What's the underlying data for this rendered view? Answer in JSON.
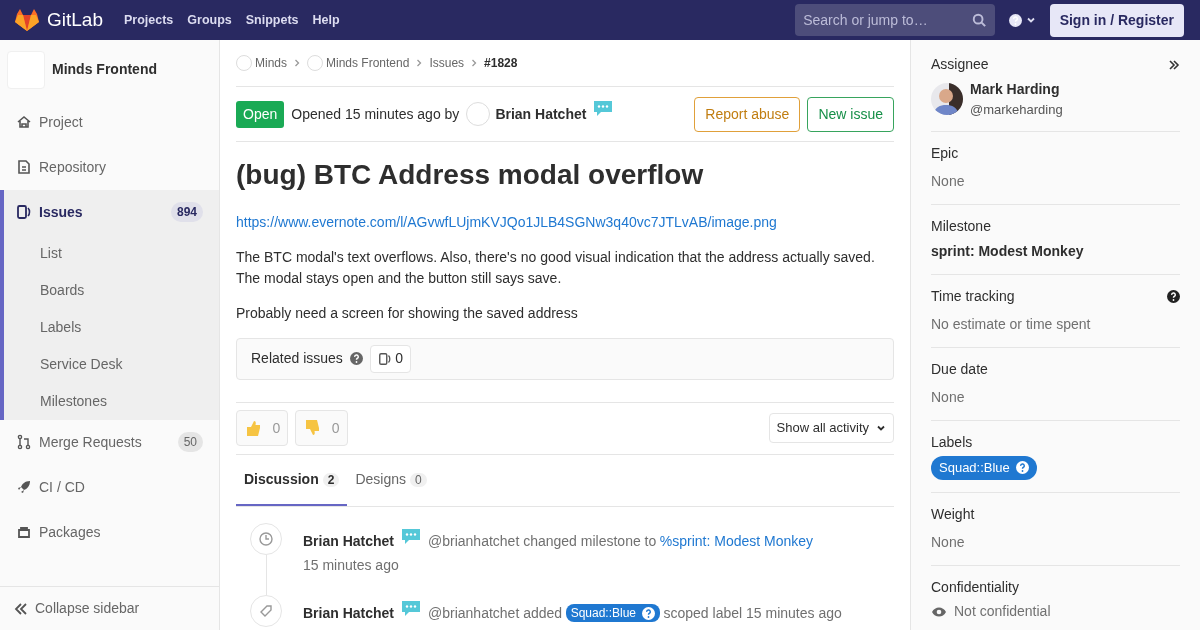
{
  "navbar": {
    "brand": "GitLab",
    "links": [
      "Projects",
      "Groups",
      "Snippets",
      "Help"
    ],
    "search": {
      "placeholder": "Search or jump to…"
    },
    "sign_in": "Sign in / Register"
  },
  "project": {
    "name": "Minds Frontend"
  },
  "sidebar": {
    "items": [
      {
        "label": "Project",
        "kind": "home",
        "selected": false
      },
      {
        "label": "Repository",
        "kind": "doc",
        "selected": false
      },
      {
        "label": "Issues",
        "kind": "issues",
        "count": "894",
        "selected": true,
        "children": [
          {
            "label": "List"
          },
          {
            "label": "Boards"
          },
          {
            "label": "Labels"
          },
          {
            "label": "Service Desk"
          },
          {
            "label": "Milestones"
          }
        ]
      },
      {
        "label": "Merge Requests",
        "kind": "merge",
        "count": "50",
        "selected": false
      },
      {
        "label": "CI / CD",
        "kind": "rocket",
        "selected": false
      },
      {
        "label": "Packages",
        "kind": "package",
        "selected": false
      }
    ],
    "collapse": "Collapse sidebar"
  },
  "breadcrumbs": [
    {
      "label": "Minds",
      "kind": "avatar"
    },
    {
      "label": "Minds Frontend",
      "kind": "avatar"
    },
    {
      "label": "Issues",
      "kind": "plain"
    },
    {
      "label": "#1828",
      "kind": "current"
    }
  ],
  "issue": {
    "status": "Open",
    "opened": "Opened 15 minutes ago by",
    "author": "Brian Hatchet",
    "buttons": [
      {
        "label": "Report abuse",
        "kind": "warning"
      },
      {
        "label": "New issue",
        "kind": "success"
      }
    ],
    "title": "(bug) BTC Address modal overflow",
    "link": "https://www.evernote.com/l/AGvwfLUjmKVJQo1JLB4SGNw3q40vc7JTLvAB/image.png",
    "paragraphs": [
      "The BTC modal's text overflows. Also, there's no good visual indication that the address actually saved. The modal stays open and the button still says save.",
      "Probably need a screen for showing the saved address"
    ]
  },
  "related": {
    "label": "Related issues",
    "count": "0"
  },
  "reactions": [
    {
      "kind": "thumbsup",
      "count": "0"
    },
    {
      "kind": "thumbsdown",
      "count": "0"
    }
  ],
  "activity_filter": "Show all activity",
  "tabs": [
    {
      "label": "Discussion",
      "count": "2",
      "selected": true
    },
    {
      "label": "Designs",
      "count": "0",
      "selected": false
    }
  ],
  "notes": [
    {
      "kind": "clock",
      "author": "Brian Hatchet",
      "segments": [
        {
          "kind": "text",
          "text": "@brianhatchet changed milestone to"
        },
        {
          "kind": "link",
          "text": "%sprint: Modest Monkey"
        }
      ],
      "time": "15 minutes ago"
    },
    {
      "kind": "tag",
      "author": "Brian Hatchet",
      "segments": [
        {
          "kind": "text",
          "text": "@brianhatchet added"
        },
        {
          "kind": "label",
          "text": "Squad::Blue"
        },
        {
          "kind": "text",
          "text": "scoped label 15 minutes ago"
        }
      ]
    }
  ],
  "right_sidebar": {
    "assignee": {
      "title": "Assignee",
      "name": "Mark Harding",
      "username": "@markeharding"
    },
    "sections": [
      {
        "title": "Epic",
        "kind": "muted",
        "value": "None"
      },
      {
        "title": "Milestone",
        "kind": "bold",
        "value": "sprint: Modest Monkey"
      },
      {
        "title": "Time tracking",
        "kind": "muted",
        "value": "No estimate or time spent",
        "help": true
      },
      {
        "title": "Due date",
        "kind": "muted",
        "value": "None"
      },
      {
        "title": "Labels",
        "kind": "label",
        "value": "Squad::Blue"
      },
      {
        "title": "Weight",
        "kind": "muted",
        "value": "None"
      },
      {
        "title": "Confidentiality",
        "kind": "confidential",
        "value": "Not confidential"
      }
    ]
  }
}
